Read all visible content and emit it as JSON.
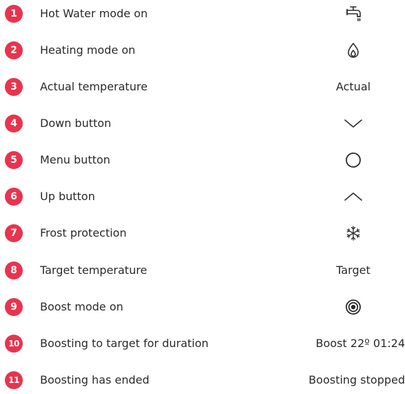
{
  "legend": {
    "items": [
      {
        "number": "1",
        "label": "Hot Water mode on",
        "symbol_icon": "tap-icon"
      },
      {
        "number": "2",
        "label": "Heating mode on",
        "symbol_icon": "flame-icon"
      },
      {
        "number": "3",
        "label": "Actual temperature",
        "symbol_text": "Actual"
      },
      {
        "number": "4",
        "label": "Down button",
        "symbol_icon": "chevron-down-icon"
      },
      {
        "number": "5",
        "label": "Menu button",
        "symbol_icon": "circle-icon"
      },
      {
        "number": "6",
        "label": "Up button",
        "symbol_icon": "chevron-up-icon"
      },
      {
        "number": "7",
        "label": "Frost protection",
        "symbol_icon": "snowflake-icon"
      },
      {
        "number": "8",
        "label": "Target temperature",
        "symbol_text": "Target"
      },
      {
        "number": "9",
        "label": "Boost mode on",
        "symbol_icon": "boost-target-icon"
      },
      {
        "number": "10",
        "label": "Boosting to target for duration",
        "symbol_text": "Boost 22º 01:24"
      },
      {
        "number": "11",
        "label": "Boosting has ended",
        "symbol_text": "Boosting stopped"
      }
    ]
  },
  "colors": {
    "badge": "#e8344e",
    "text": "#2a2a2a",
    "background": "#ffffff"
  }
}
